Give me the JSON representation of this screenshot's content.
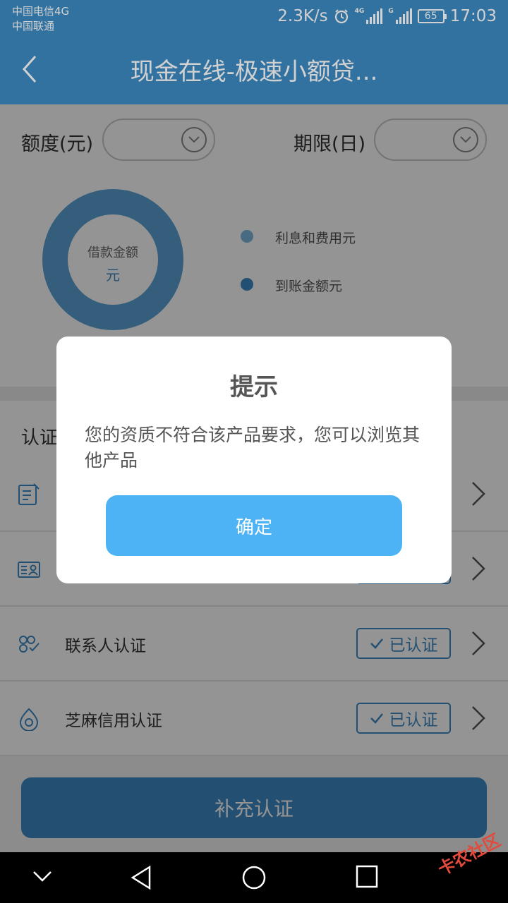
{
  "status_bar": {
    "carrier_1": "中国电信4G",
    "carrier_2": "中国联通",
    "net_speed": "2.3K/s",
    "net_tag_1": "4G",
    "net_tag_2": "G",
    "battery": "65",
    "time": "17:03"
  },
  "header": {
    "title": "现金在线-极速小额贷..."
  },
  "filters": {
    "amount_label": "额度(元)",
    "amount_value": "",
    "term_label": "期限(日)",
    "term_value": ""
  },
  "loan_chart": {
    "center_label": "借款金额",
    "center_unit": "元",
    "legend": [
      {
        "label": "利息和费用元",
        "color": "#7fb8e0"
      },
      {
        "label": "到账金额元",
        "color": "#3d8bc4"
      }
    ]
  },
  "auth_section": {
    "title": "认证",
    "rows": [
      {
        "label": "",
        "icon": "document-edit-icon",
        "status": ""
      },
      {
        "label": "",
        "icon": "id-card-icon",
        "status": ""
      },
      {
        "label": "联系人认证",
        "icon": "contacts-icon",
        "status": "已认证"
      },
      {
        "label": "芝麻信用认证",
        "icon": "sesame-credit-icon",
        "status": "已认证"
      }
    ]
  },
  "submit": {
    "label": "补充认证"
  },
  "dialog": {
    "title": "提示",
    "message": "您的资质不符合该产品要求，您可以浏览其他产品",
    "confirm_label": "确定"
  },
  "watermark": {
    "text": "卡农社区"
  },
  "colors": {
    "primary": "#3d8bc4",
    "dialog_button": "#4db3f4"
  }
}
